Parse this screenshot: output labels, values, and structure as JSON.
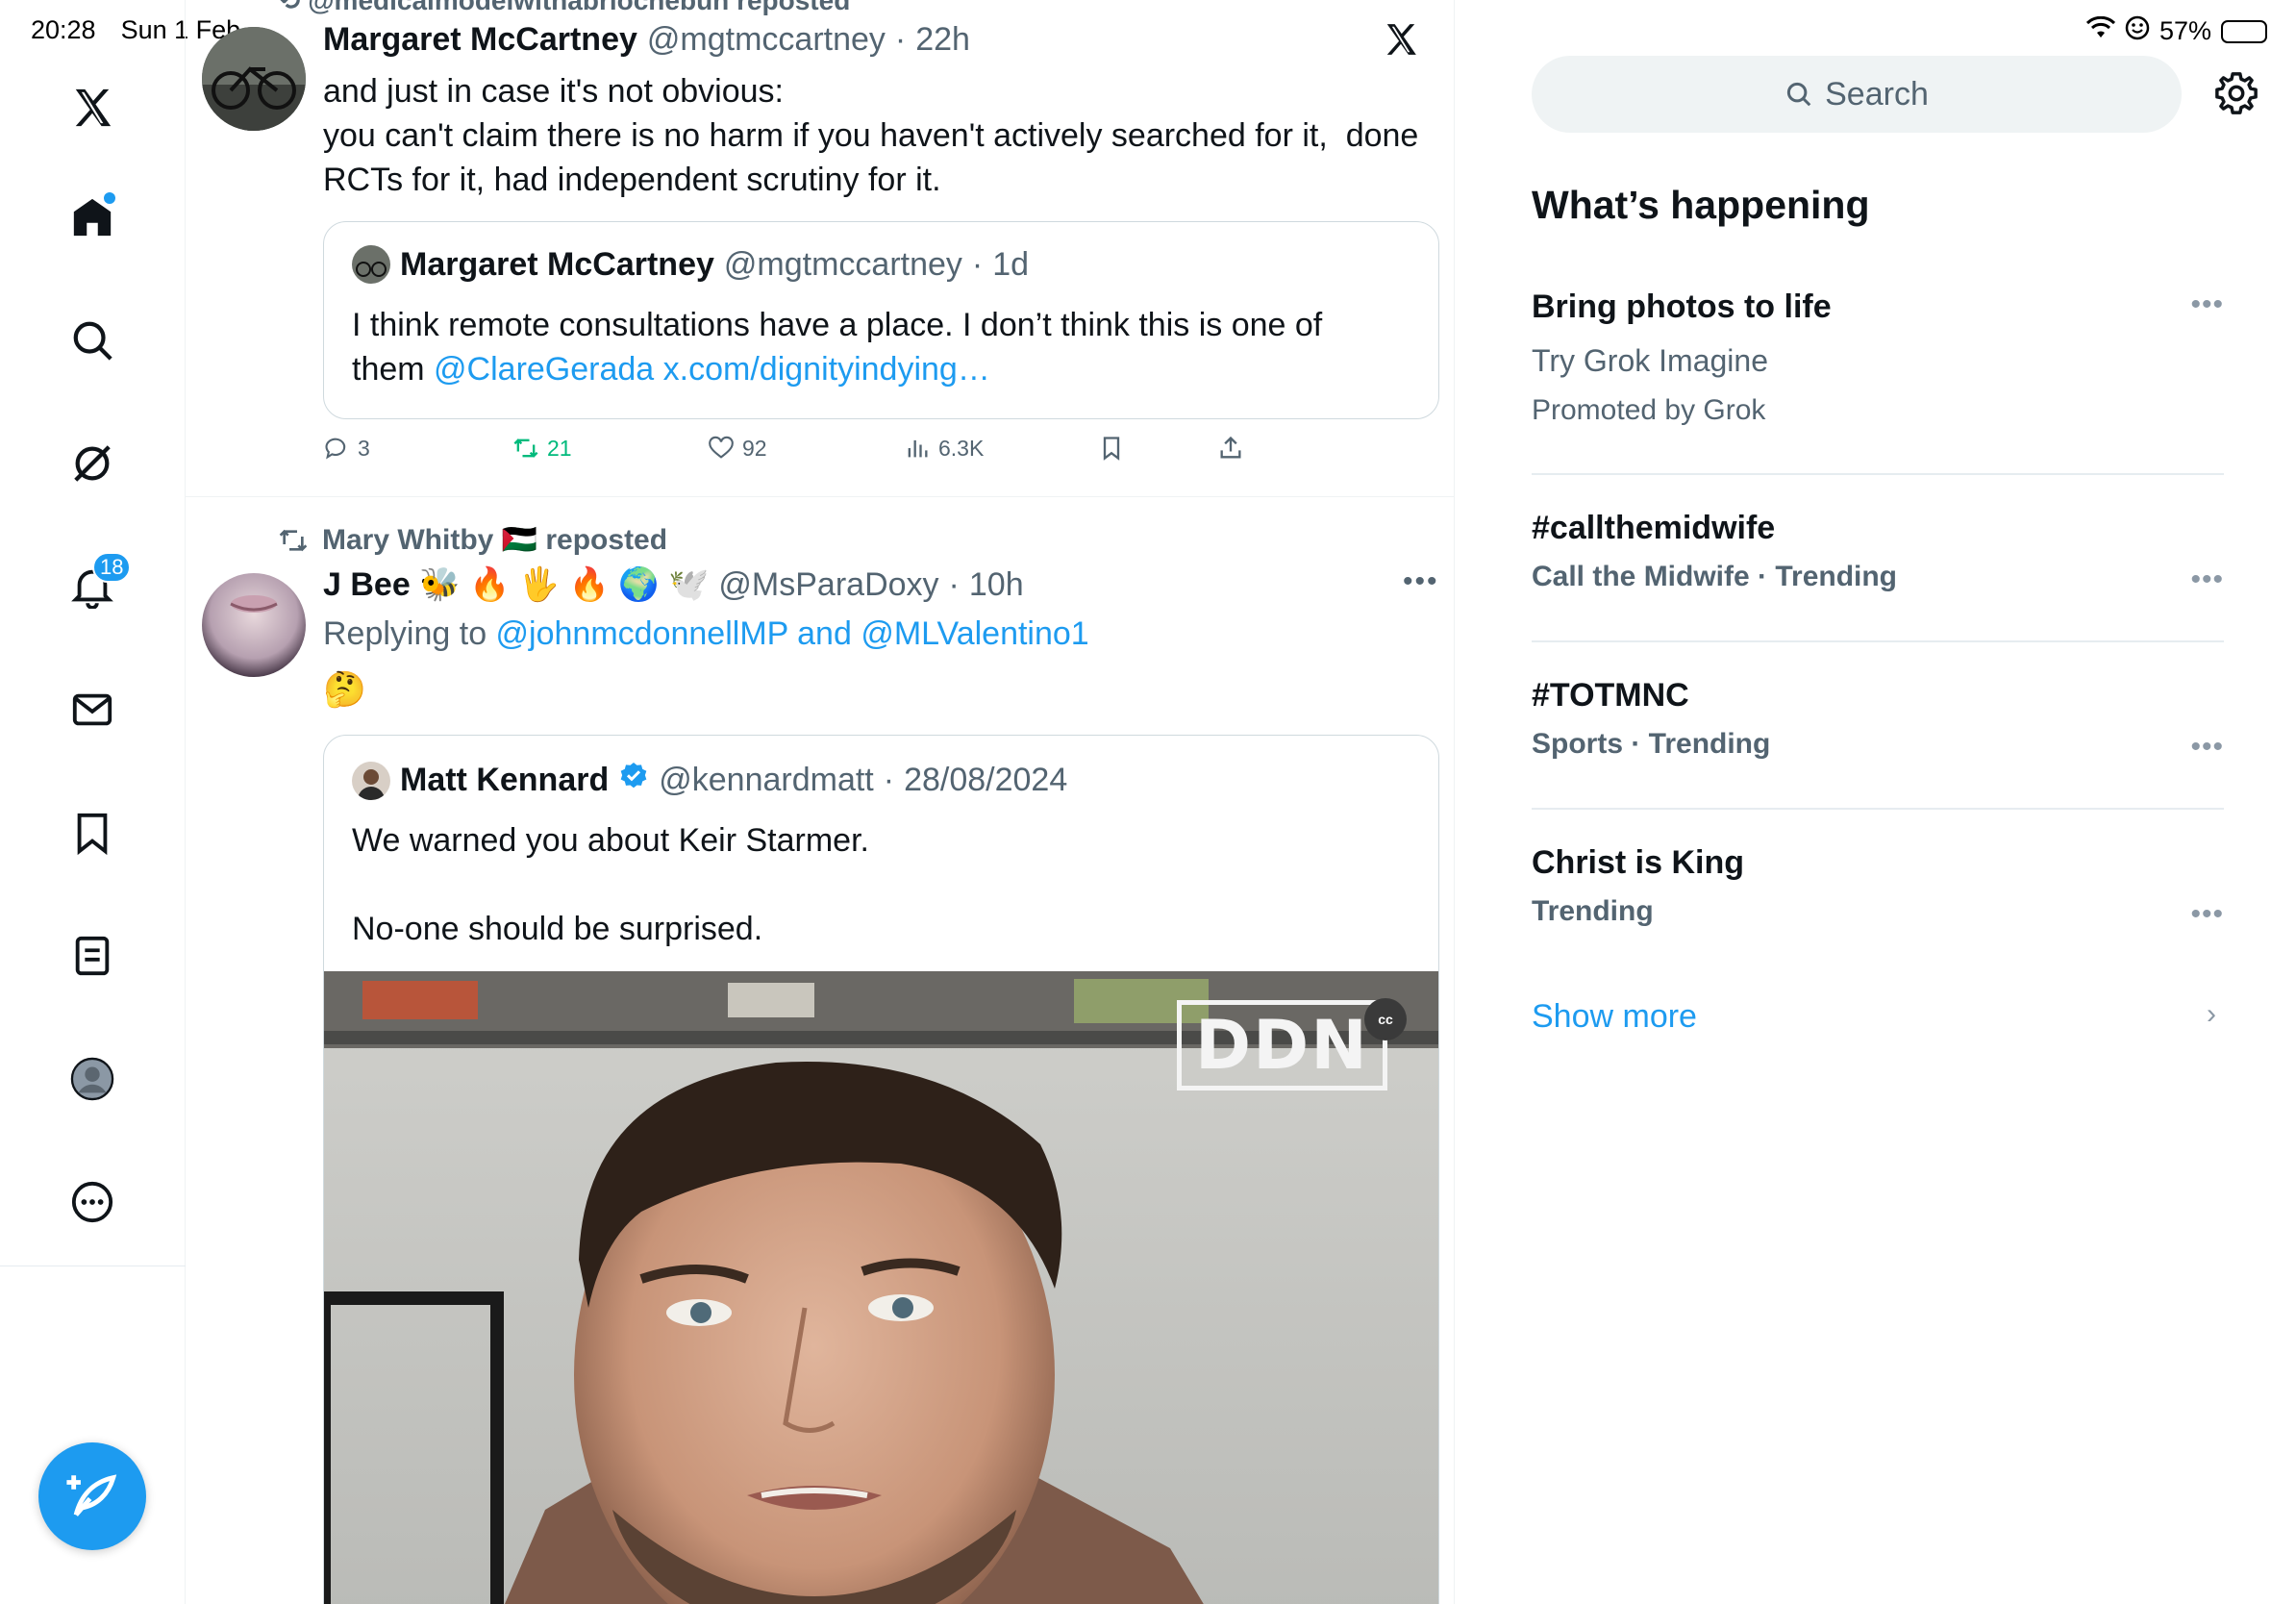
{
  "status_bar": {
    "time": "20:28",
    "date": "Sun 1 Feb",
    "battery": "57%",
    "battery_level": 0.57
  },
  "nav": {
    "notifications_count": "18",
    "icons": [
      "x-logo-icon",
      "home-icon",
      "search-icon",
      "grok-icon",
      "bell-icon",
      "mail-icon",
      "bookmark-icon",
      "lists-icon",
      "profile-icon",
      "more-icon",
      "compose-icon"
    ]
  },
  "tweet1": {
    "repost_line": "@medicalmodelwithabriochebun reposted",
    "name": "Margaret McCartney",
    "handle": "@mgtmccartney",
    "sep": "·",
    "time": "22h",
    "text_line1": "and just in case it's not obvious:",
    "text_line2": "you can't claim there is no harm if you haven't actively searched for it,  done",
    "text_line3": "RCTs for it, had independent scrutiny for it.",
    "quote": {
      "name": "Margaret McCartney",
      "handle": "@mgtmccartney",
      "sep": "·",
      "time": "1d",
      "text_line1": "I think remote consultations have a place. I don’t think this is one of",
      "text_line2_prefix": "them ",
      "mention": "@ClareGerada",
      "url": "x.com/dignityindying…"
    },
    "actions": {
      "replies": "3",
      "reposts": "21",
      "likes": "92",
      "views": "6.3K"
    }
  },
  "tweet2": {
    "reposted_by": "Mary Whitby 🇵🇸 reposted",
    "name": "J Bee 🐝 🔥 🖐️ 🔥 🌍 🕊️",
    "handle": "@MsParaDoxy",
    "sep": "·",
    "time": "10h",
    "replying_prefix": "Replying to ",
    "replying_to": "@johnmcdonnellMP and @MLValentino1",
    "text": "🤔",
    "quote": {
      "name": "Matt Kennard",
      "handle": "@kennardmatt",
      "sep": "·",
      "time": "28/08/2024",
      "text_line1": "We warned you about Keir Starmer.",
      "text_line2": "No-one should be surprised.",
      "video_watermark": "DDN",
      "cc_label": "cc"
    }
  },
  "sidebar": {
    "search_placeholder": "Search",
    "title": "What’s happening",
    "trends": [
      {
        "title": "Bring photos to life",
        "subtitle": "Try Grok Imagine",
        "meta": "Promoted by Grok"
      },
      {
        "title": "#callthemidwife",
        "meta": "Call the Midwife · Trending"
      },
      {
        "title": "#TOTMNC",
        "meta": "Sports · Trending"
      },
      {
        "title": "Christ is King",
        "meta": "Trending"
      }
    ],
    "more_glyph": "•••",
    "show_more": "Show more"
  },
  "colors": {
    "accent": "#1d9bf0",
    "repost_green": "#00ba7c",
    "muted": "#536471",
    "border": "#eff3f4"
  }
}
